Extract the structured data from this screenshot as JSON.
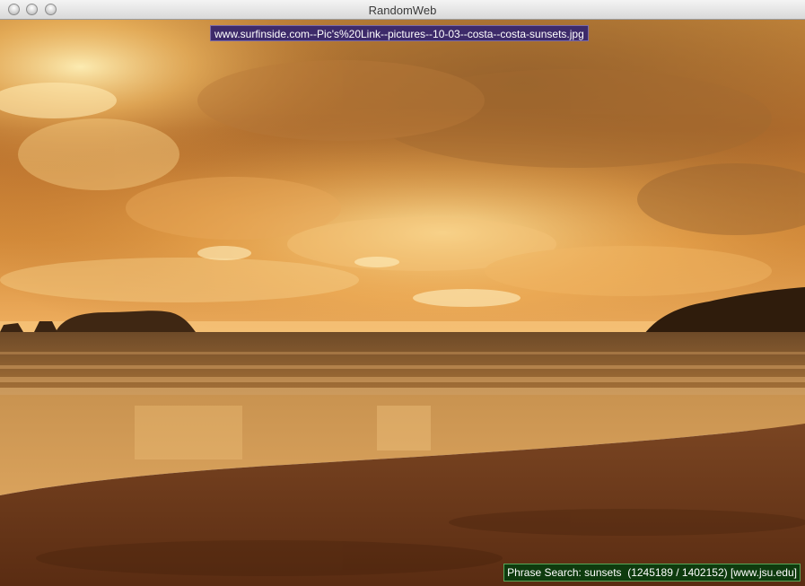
{
  "window": {
    "title": "RandomWeb"
  },
  "image": {
    "source_label": "www.surfinside.com--Pic's%20Link--pictures--10-03--costa--costa-sunsets.jpg"
  },
  "status": {
    "text": "Phrase Search: sunsets  (1245189 / 1402152) [www.jsu.edu]"
  },
  "colors": {
    "url_label_bg": "#3d2a6a",
    "status_label_bg": "#0e3b0e",
    "status_label_border": "#58a858"
  },
  "icons": {
    "close": "close-icon",
    "minimize": "minimize-icon",
    "zoom": "zoom-icon"
  }
}
